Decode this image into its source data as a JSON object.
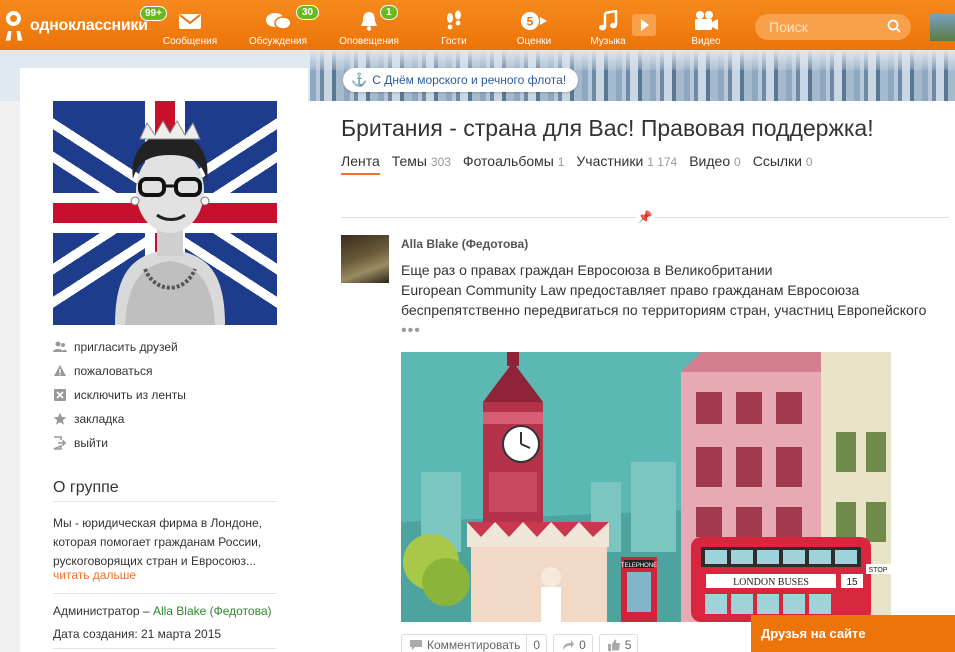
{
  "header": {
    "logo_text": "одноклассники",
    "logo_badge": "99+",
    "nav": [
      {
        "label": "Сообщения",
        "icon": "envelope-icon",
        "badge": ""
      },
      {
        "label": "Обсуждения",
        "icon": "chat-icon",
        "badge": "30"
      },
      {
        "label": "Оповещения",
        "icon": "bell-icon",
        "badge": "1"
      },
      {
        "label": "Гости",
        "icon": "footprints-icon",
        "badge": ""
      },
      {
        "label": "Оценки",
        "icon": "rating-icon",
        "badge": ""
      },
      {
        "label": "Музыка",
        "icon": "music-icon",
        "badge": ""
      },
      {
        "label": "Видео",
        "icon": "video-camera-icon",
        "badge": ""
      }
    ],
    "search_placeholder": "Поиск"
  },
  "cover": {
    "holiday_text": "С Днём морского и речного флота!"
  },
  "sidebar": {
    "menu": [
      {
        "label": "пригласить друзей",
        "icon": "invite-friends-icon"
      },
      {
        "label": "пожаловаться",
        "icon": "warning-icon"
      },
      {
        "label": "исключить из ленты",
        "icon": "hide-from-feed-icon"
      },
      {
        "label": "закладка",
        "icon": "star-icon"
      },
      {
        "label": "выйти",
        "icon": "logout-icon"
      }
    ],
    "about_title": "О группе",
    "about_text": "Мы - юридическая фирма в Лондоне, которая помогает гражданам России, рускоговорящих стран и Евросоюз...",
    "read_more": "читать дальше",
    "admin_label": "Администратор –",
    "admin_name": "Alla Blake (Федотова)",
    "created": "Дата создания: 21 марта 2015"
  },
  "group": {
    "title": "Британия - страна для Вас! Правовая поддержка!",
    "tabs": [
      {
        "label": "Лента",
        "count": "",
        "active": true
      },
      {
        "label": "Темы",
        "count": "303"
      },
      {
        "label": "Фотоальбомы",
        "count": "1"
      },
      {
        "label": "Участники",
        "count": "1 174"
      },
      {
        "label": "Видео",
        "count": "0"
      },
      {
        "label": "Ссылки",
        "count": "0"
      }
    ]
  },
  "post": {
    "author": "Alla Blake (Федотова)",
    "lines": [
      "Еще раз о правах граждан Евросоюза в Великобритании",
      "European Community Law предоставляет право гражданам Евросоюза",
      "беспрепятственно передвигаться по территориям стран, участниц Европейского"
    ],
    "more": "•••",
    "image_labels": {
      "bus_sign": "LONDON BUSES",
      "bus_number": "15",
      "booth_sign": "TELEPHONE",
      "stop_sign": "STOP"
    },
    "actions": {
      "comment_label": "Комментировать",
      "comment_count": "0",
      "share_count": "0",
      "like_count": "5"
    }
  },
  "friends_bar": "Друзья на сайте",
  "colors": {
    "brand_orange": "#ec7409",
    "badge_green": "#6ab820",
    "link_green": "#2b8a2b",
    "link_orange": "#eb722e"
  }
}
